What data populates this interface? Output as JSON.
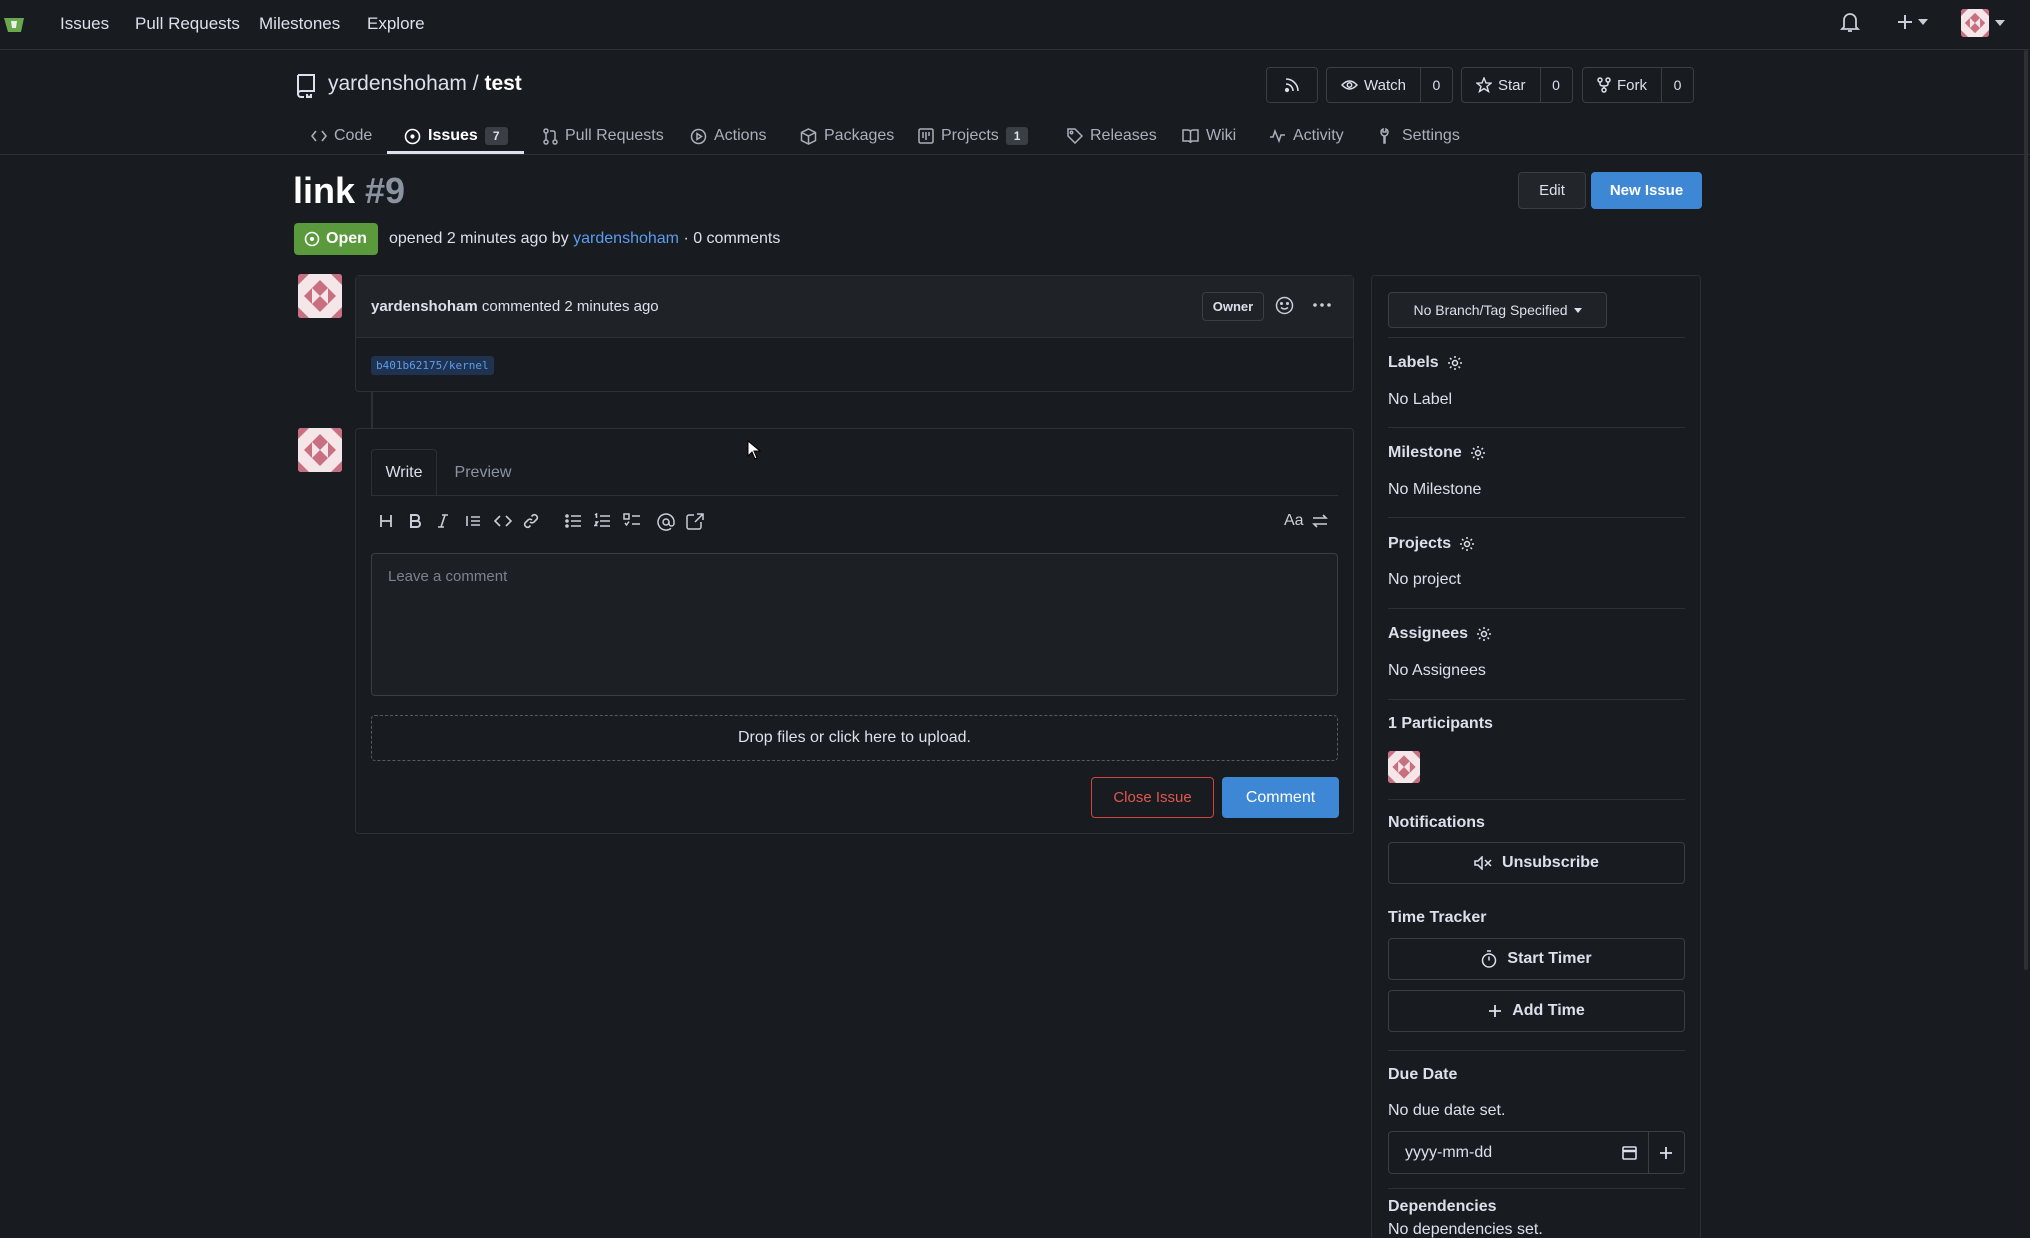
{
  "topnav": {
    "items": [
      {
        "label": "Issues"
      },
      {
        "label": "Pull Requests"
      },
      {
        "label": "Milestones"
      },
      {
        "label": "Explore"
      }
    ]
  },
  "repo": {
    "owner": "yardenshoham",
    "separator": "/",
    "name": "test",
    "watch_label": "Watch",
    "watch_count": "0",
    "star_label": "Star",
    "star_count": "0",
    "fork_label": "Fork",
    "fork_count": "0"
  },
  "tabs": [
    {
      "label": "Code"
    },
    {
      "label": "Issues",
      "badge": "7"
    },
    {
      "label": "Pull Requests"
    },
    {
      "label": "Actions"
    },
    {
      "label": "Packages"
    },
    {
      "label": "Projects",
      "badge": "1"
    },
    {
      "label": "Releases"
    },
    {
      "label": "Wiki"
    },
    {
      "label": "Activity"
    },
    {
      "label": "Settings"
    }
  ],
  "issue": {
    "title": "link",
    "number": "#9",
    "edit_label": "Edit",
    "new_issue_label": "New Issue",
    "status": "Open",
    "meta_prefix": "opened 2 minutes ago by",
    "meta_author": "yardenshoham",
    "meta_suffix": "· 0 comments"
  },
  "comment": {
    "author": "yardenshoham",
    "action": "commented 2 minutes ago",
    "owner_badge": "Owner",
    "body_ref": "b401b62175/kernel"
  },
  "editor": {
    "write_tab": "Write",
    "preview_tab": "Preview",
    "placeholder": "Leave a comment",
    "dropzone": "Drop files or click here to upload.",
    "close_issue_label": "Close Issue",
    "comment_label": "Comment",
    "font_toggle": "Aa"
  },
  "sidebar": {
    "branch": "No Branch/Tag Specified",
    "labels_title": "Labels",
    "labels_value": "No Label",
    "milestone_title": "Milestone",
    "milestone_value": "No Milestone",
    "projects_title": "Projects",
    "projects_value": "No project",
    "assignees_title": "Assignees",
    "assignees_value": "No Assignees",
    "participants_title": "1 Participants",
    "notifications_title": "Notifications",
    "unsubscribe_label": "Unsubscribe",
    "time_tracker_title": "Time Tracker",
    "start_timer_label": "Start Timer",
    "add_time_label": "Add Time",
    "due_date_title": "Due Date",
    "due_date_value": "No due date set.",
    "due_date_placeholder": "yyyy-mm-dd",
    "dependencies_title": "Dependencies",
    "dependencies_value": "No dependencies set."
  },
  "colors": {
    "accent": "#3e87d4",
    "open_green": "#5b9a3c",
    "danger": "#d0453f",
    "link": "#5b9cf0",
    "background": "#181b1f"
  }
}
